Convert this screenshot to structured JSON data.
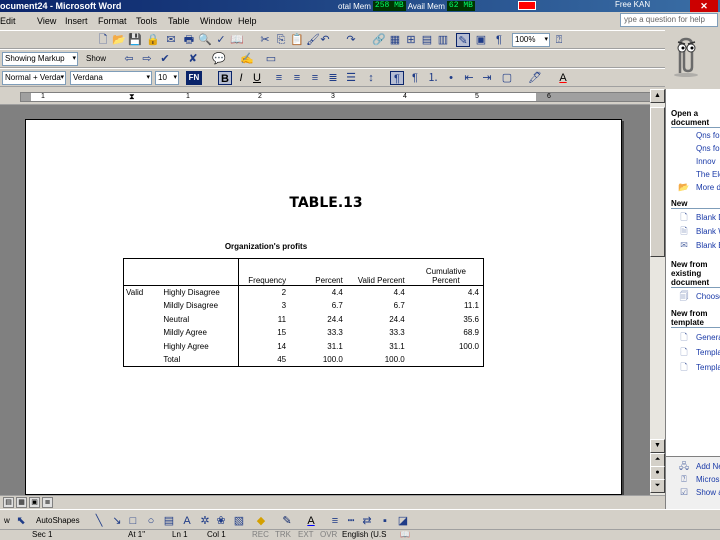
{
  "window": {
    "title": "ocument24 - Microsoft Word",
    "memory": {
      "total_label": "otal Mem",
      "total_value": "258 MB",
      "avail_label": "Avail Mem",
      "avail_value": "62 MB"
    },
    "tray_text": "Free KAN"
  },
  "menu": {
    "items": [
      "Edit",
      "View",
      "Insert",
      "Format",
      "Tools",
      "Table",
      "Window",
      "Help"
    ],
    "help_search_placeholder": "ype a question for help"
  },
  "toolbar_standard": {
    "zoom": "100%"
  },
  "toolbar_reviewing": {
    "display_for_review": "Showing Markup",
    "show_label": "Show"
  },
  "toolbar_format": {
    "style": "Normal + Verda",
    "font": "Verdana",
    "size": "10",
    "font_color_code": "FN",
    "bold": "B",
    "italic": "I",
    "underline": "U"
  },
  "ruler": {
    "numbers": [
      "1",
      "1",
      "2",
      "3",
      "4",
      "5",
      "6"
    ]
  },
  "document": {
    "heading": "TABLE.13",
    "table_caption": "Organization's profits",
    "table": {
      "headers": {
        "frequency": "Frequency",
        "percent": "Percent",
        "valid_percent": "Valid Percent",
        "cumulative_percent_line1": "Cumulative",
        "cumulative_percent_line2": "Percent"
      },
      "group_label": "Valid",
      "rows": [
        {
          "label": "Highly Disagree",
          "frequency": "2",
          "percent": "4.4",
          "valid_percent": "4.4",
          "cumulative_percent": "4.4"
        },
        {
          "label": "Mildly Disagree",
          "frequency": "3",
          "percent": "6.7",
          "valid_percent": "6.7",
          "cumulative_percent": "11.1"
        },
        {
          "label": "Neutral",
          "frequency": "11",
          "percent": "24.4",
          "valid_percent": "24.4",
          "cumulative_percent": "35.6"
        },
        {
          "label": "Mildly Agree",
          "frequency": "15",
          "percent": "33.3",
          "valid_percent": "33.3",
          "cumulative_percent": "68.9"
        },
        {
          "label": "Highly Agree",
          "frequency": "14",
          "percent": "31.1",
          "valid_percent": "31.1",
          "cumulative_percent": "100.0"
        },
        {
          "label": "Total",
          "frequency": "45",
          "percent": "100.0",
          "valid_percent": "100.0",
          "cumulative_percent": ""
        }
      ]
    }
  },
  "task_pane": {
    "open_heading_1": "Open a",
    "open_heading_2": "document",
    "open_items": [
      "Qns fo",
      "Qns fo",
      "Innov",
      "The Ele"
    ],
    "more_docs": "More d",
    "new_heading": "New",
    "new_items": [
      "Blank D",
      "Blank W",
      "Blank E"
    ],
    "existing_heading_1": "New from",
    "existing_heading_2": "existing",
    "existing_heading_3": "document",
    "choose": "Choose",
    "template_heading_1": "New from",
    "template_heading_2": "template",
    "template_items": [
      "Genera",
      "Templa",
      "Templa"
    ],
    "bottom_items": [
      "Add Ne",
      "Micros",
      "Show a"
    ]
  },
  "drawing_toolbar": {
    "draw_label": "w",
    "autoshapes_label": "AutoShapes"
  },
  "status_bar": {
    "page": "Sec 1",
    "at": "At 1\"",
    "ln": "Ln 1",
    "col": "Col 1",
    "rec": "REC",
    "trk": "TRK",
    "ext": "EXT",
    "ovr": "OVR",
    "language": "English (U.S"
  }
}
